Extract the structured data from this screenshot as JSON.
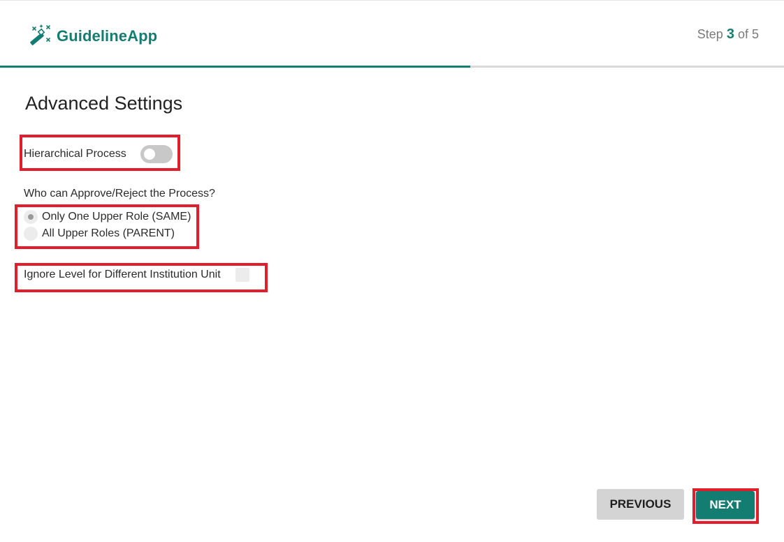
{
  "header": {
    "app_name": "GuidelineApp",
    "logo_icon": "magic-wand-icon",
    "step": {
      "prefix": "Step",
      "current": "3",
      "separator": "of",
      "total": "5"
    }
  },
  "progress": {
    "fraction": 0.6,
    "fill_color": "#137d72",
    "track_color": "#d9d9d9"
  },
  "page_title": "Advanced Settings",
  "hierarchical_process": {
    "label": "Hierarchical Process",
    "enabled": false
  },
  "approval": {
    "question": "Who can Approve/Reject the Process?",
    "options": [
      {
        "label": "Only One Upper Role (SAME)",
        "selected": true
      },
      {
        "label": "All Upper Roles (PARENT)",
        "selected": false
      }
    ]
  },
  "ignore_level": {
    "label": "Ignore Level for Different Institution Unit",
    "checked": false
  },
  "buttons": {
    "previous": "PREVIOUS",
    "next": "NEXT"
  },
  "colors": {
    "accent": "#137d72",
    "highlight": "#e41d2c",
    "button_secondary": "#d4d4d4"
  }
}
